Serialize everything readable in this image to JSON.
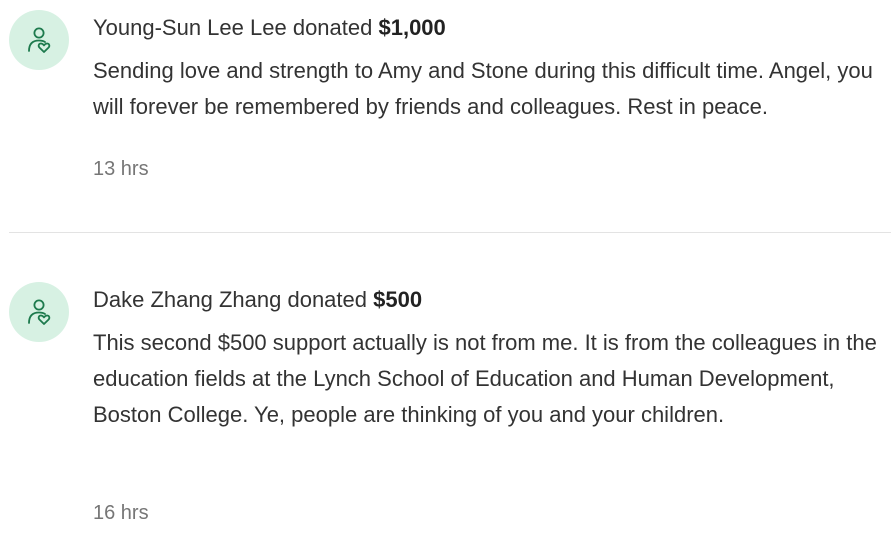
{
  "donations": [
    {
      "donor": "Young-Sun Lee Lee",
      "action": "donated",
      "amount": "$1,000",
      "message": "Sending love and strength to Amy and Stone during this difficult time. Angel, you will forever be remembered by friends and colleagues. Rest in peace.",
      "time": "13 hrs",
      "icon": "donor-heart-icon"
    },
    {
      "donor": "Dake Zhang Zhang",
      "action": "donated",
      "amount": "$500",
      "message": "This second $500 support actually is not from me. It is from the colleagues in the education fields at the Lynch School of Education and Human Development, Boston College. Ye, people are thinking of you and your children.",
      "time": "16 hrs",
      "icon": "donor-heart-icon"
    }
  ],
  "colors": {
    "avatar_bg": "#d7f1e3",
    "icon_stroke": "#1d7a4d",
    "text": "#333333",
    "muted": "#767676",
    "divider": "#e3e3e3"
  }
}
